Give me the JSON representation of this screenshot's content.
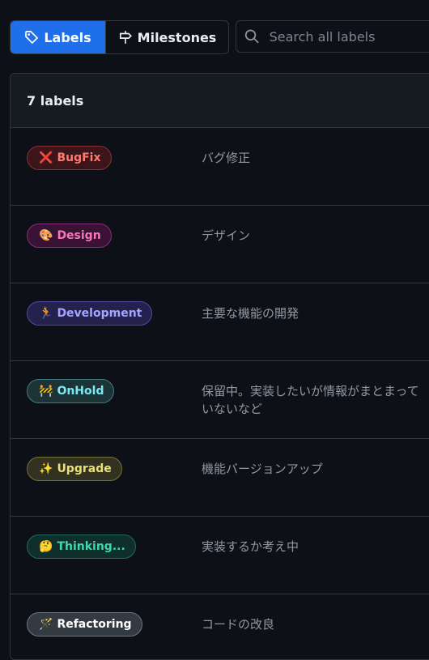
{
  "nav": {
    "labels_tab": "Labels",
    "milestones_tab": "Milestones",
    "search_placeholder": "Search all labels"
  },
  "list": {
    "count_text": "7 labels",
    "labels": [
      {
        "emoji": "❌",
        "name": "BugFix",
        "description": "バグ修正",
        "text_color": "#ff7b72",
        "bg": "#3b1519",
        "border": "#8e2f33"
      },
      {
        "emoji": "🎨",
        "name": "Design",
        "description": "デザイン",
        "text_color": "#f778ba",
        "bg": "#3a1236",
        "border": "#8a2b7f"
      },
      {
        "emoji": "🏃",
        "name": "Development",
        "description": "主要な機能の開発",
        "text_color": "#a5a5ff",
        "bg": "#24214d",
        "border": "#4f4aa6"
      },
      {
        "emoji": "🚧",
        "name": "OnHold",
        "description": "保留中。実装したいが情報がまとまっていないなど",
        "text_color": "#7ee8f0",
        "bg": "#1c3338",
        "border": "#417c86"
      },
      {
        "emoji": "✨",
        "name": "Upgrade",
        "description": "機能バージョンアップ",
        "text_color": "#e8e07a",
        "bg": "#333120",
        "border": "#77713a"
      },
      {
        "emoji": "🤔",
        "name": "Thinking...",
        "description": "実装するか考え中",
        "text_color": "#3fd6b0",
        "bg": "#0f2f2b",
        "border": "#206a5d"
      },
      {
        "emoji": "🪄",
        "name": "Refactoring",
        "description": "コードの改良",
        "text_color": "#ffffff",
        "bg": "#343a42",
        "border": "#6e7681"
      }
    ]
  }
}
